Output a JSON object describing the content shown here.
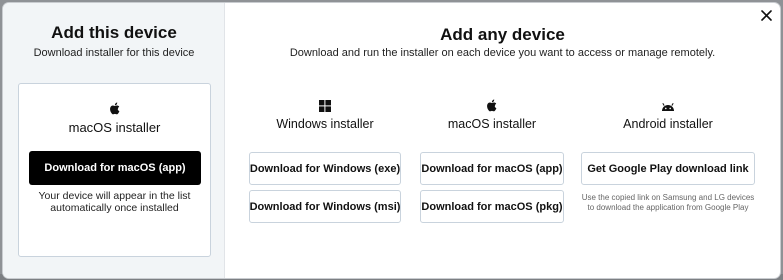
{
  "left": {
    "title": "Add this device",
    "subtitle": "Download installer for this device",
    "card": {
      "icon": "apple-icon",
      "title": "macOS installer",
      "button_label": "Download for macOS (app)",
      "note": "Your device will appear in the list automatically once installed"
    }
  },
  "right": {
    "title": "Add any device",
    "subtitle": "Download and run the installer on each device you want to access or manage remotely.",
    "columns": [
      {
        "icon": "windows-icon",
        "label": "Windows installer",
        "buttons": [
          "Download for Windows (exe)",
          "Download for Windows (msi)"
        ]
      },
      {
        "icon": "apple-icon",
        "label": "macOS installer",
        "buttons": [
          "Download for macOS (app)",
          "Download for macOS (pkg)"
        ]
      },
      {
        "icon": "android-icon",
        "label": "Android installer",
        "buttons": [
          "Get Google Play download link"
        ],
        "note": "Use the copied link on Samsung and LG devices to download the application from Google Play"
      }
    ]
  },
  "close": {
    "icon": "close-icon"
  },
  "colors": {
    "primary_button": "#000000",
    "panel_bg": "#f2f5f7",
    "border": "#c9d3dd",
    "backdrop": "#8f9296"
  }
}
